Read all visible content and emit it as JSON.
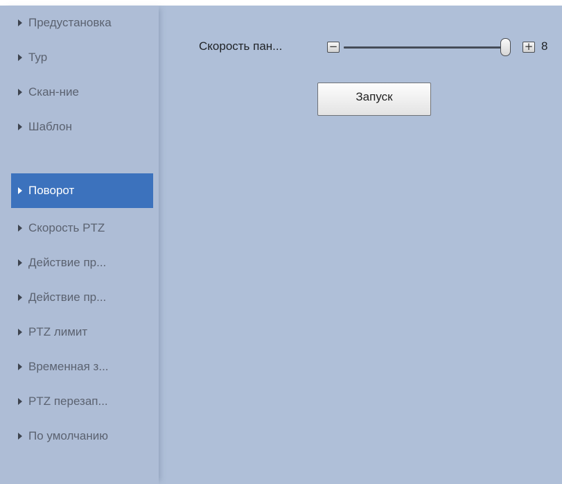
{
  "sidebar": {
    "active_index": 4,
    "items": [
      {
        "label": "Предустановка"
      },
      {
        "label": "Тур"
      },
      {
        "label": "Скан-ние"
      },
      {
        "label": "Шаблон"
      },
      {
        "label": "Поворот"
      },
      {
        "label": "Скорость PTZ"
      },
      {
        "label": "Действие пр..."
      },
      {
        "label": "Действие пр..."
      },
      {
        "label": "PTZ лимит"
      },
      {
        "label": "Временная з..."
      },
      {
        "label": "PTZ перезап..."
      },
      {
        "label": "По умолчанию"
      }
    ]
  },
  "pan": {
    "speed_label": "Скорость пан...",
    "minus_symbol": "−",
    "plus_symbol": "+",
    "value": "8",
    "slider_fraction": 1.0,
    "start_label": "Запуск"
  },
  "colors": {
    "background": "#afbfd8",
    "active_item": "#3c72bd",
    "active_text": "#ffffff",
    "item_text": "#5b6270"
  },
  "icons": {
    "nav_arrow": "caret-right-icon",
    "minus": "minus-icon",
    "plus": "plus-icon"
  }
}
